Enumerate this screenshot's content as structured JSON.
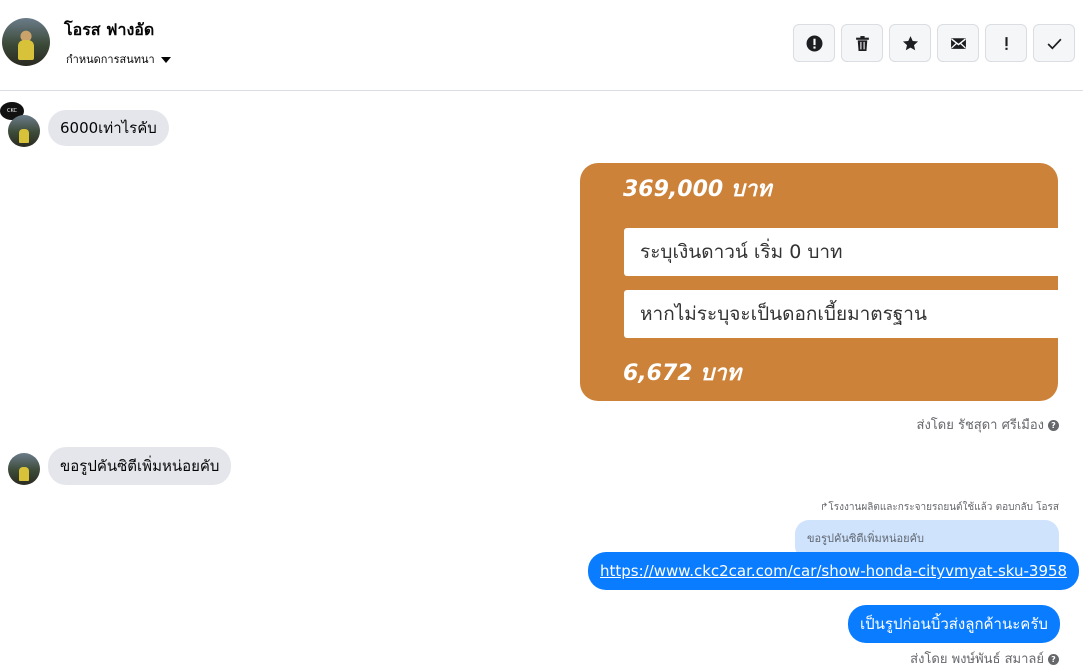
{
  "header": {
    "contact_name": "โอรส ฟางอัด",
    "assign_label": "กำหนดการสนทนา",
    "actions": [
      {
        "name": "alert-button",
        "icon": "exclamation-circle-icon"
      },
      {
        "name": "delete-button",
        "icon": "trash-icon"
      },
      {
        "name": "star-button",
        "icon": "star-icon"
      },
      {
        "name": "mail-button",
        "icon": "envelope-icon"
      },
      {
        "name": "spam-button",
        "icon": "exclamation-icon"
      },
      {
        "name": "done-button",
        "icon": "check-icon"
      }
    ]
  },
  "messages": {
    "incoming_1": "6000เท่าไรคับ",
    "card": {
      "price": "369,000 บาท",
      "down_payment_placeholder": "ระบุเงินดาวน์ เริ่ม 0 บาท",
      "interest_placeholder": "หากไม่ระบุจะเป็นดอกเบี้ยมาตรฐาน",
      "monthly": "6,672 บาท"
    },
    "sent_by_1": "ส่งโดย รัชสุดา ศรีเมือง",
    "incoming_2": "ขอรูปคันซิตีเพิ่มหน่อยคับ",
    "reply_note": "โรงงานผลิตและกระจายรถยนต์ใช้แล้ว ตอบกลับ โอรส",
    "quoted_text": "ขอรูปคันซิตีเพิ่มหน่อยคับ",
    "link": "https://www.ckc2car.com/car/show-honda-cityvmyat-sku-3958",
    "outgoing_2": "เป็นรูปก่อนบิ้วส่งลูกค้านะครับ",
    "sent_by_2": "ส่งโดย พงษ์พันธ์ สมาลย์"
  },
  "colors": {
    "card_bg": "#cd823a",
    "outgoing_bubble": "#0a7cff",
    "incoming_bubble": "#e4e6eb",
    "quoted_bubble": "#cfe3fd"
  }
}
